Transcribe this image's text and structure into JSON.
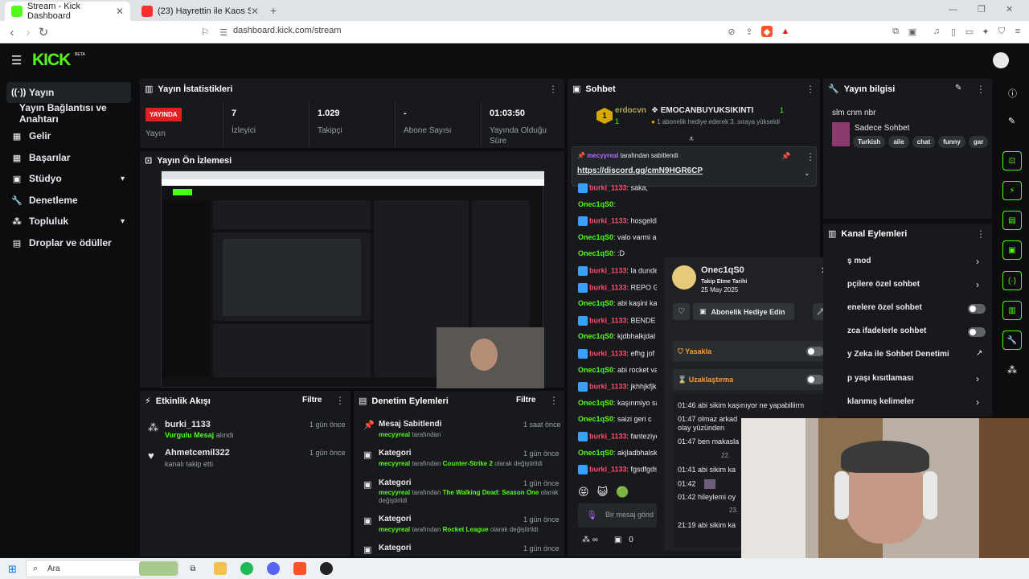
{
  "browser": {
    "tabs": [
      {
        "title": "Stream - Kick Dashboard"
      },
      {
        "title": "(23) Hayrettin ile Kaos Show - 2.Sezo"
      }
    ],
    "url": "dashboard.kick.com/stream"
  },
  "brand": {
    "logo": "KICK",
    "beta": "BETA"
  },
  "sidebar": {
    "items": [
      {
        "label": "Yayın",
        "icon": "broadcast-icon"
      },
      {
        "label": "Yayın Bağlantısı ve Anahtarı"
      },
      {
        "label": "Gelir",
        "icon": "revenue-icon"
      },
      {
        "label": "Başarılar",
        "icon": "achievements-icon"
      },
      {
        "label": "Stüdyo",
        "icon": "studio-icon"
      },
      {
        "label": "Denetleme",
        "icon": "moderation-icon"
      },
      {
        "label": "Topluluk",
        "icon": "community-icon"
      },
      {
        "label": "Droplar ve ödüller",
        "icon": "drops-icon"
      }
    ]
  },
  "stats": {
    "title": "Yayın İstatistikleri",
    "live_label": "YAYINDA",
    "status_label": "Yayın",
    "viewers": "7",
    "viewers_label": "İzleyici",
    "followers": "1.029",
    "followers_label": "Takipçi",
    "subs": "-",
    "subs_label": "Abone Sayısı",
    "uptime": "01:03:50",
    "uptime_label": "Yayında Olduğu Süre"
  },
  "preview": {
    "title": "Yayın Ön İzlemesi"
  },
  "activity": {
    "title": "Etkinlik Akışı",
    "filter": "Filtre",
    "items": [
      {
        "user": "burki_1133",
        "time": "1 gün önce",
        "detail_highlight": "Vurgulu Mesaj",
        "detail": "alındı"
      },
      {
        "user": "Ahmetcemil322",
        "time": "1 gün önce",
        "detail_highlight": "",
        "detail": "kanalı takip etti"
      }
    ]
  },
  "modlog": {
    "title": "Denetim Eylemleri",
    "filter": "Filtre",
    "items": [
      {
        "title": "Mesaj Sabitlendi",
        "time": "1 saat önce",
        "user": "mecyyreal",
        "mid": "tarafından",
        "target": "",
        "end": ""
      },
      {
        "title": "Kategori",
        "time": "1 gün önce",
        "user": "mecyyreal",
        "mid": "tarafından",
        "target": "Counter-Strike 2",
        "end": "olarak değiştirildi"
      },
      {
        "title": "Kategori",
        "time": "1 gün önce",
        "user": "mecyyreal",
        "mid": "tarafından",
        "target": "The Walking Dead: Season One",
        "end": "olarak değiştirildi"
      },
      {
        "title": "Kategori",
        "time": "1 gün önce",
        "user": "mecyyreal",
        "mid": "tarafından",
        "target": "Rocket League",
        "end": "olarak değiştirildi"
      },
      {
        "title": "Kategori",
        "time": "1 gün önce"
      }
    ]
  },
  "chat": {
    "title": "Sohbet",
    "gifter": {
      "name": "erdocvn",
      "count": "1",
      "rank": "1",
      "target": "EMOCANBUYUKSIKINTI",
      "target_count": "1",
      "note": "1 abonelik hediye ederek 3. sıraya yükseldi"
    },
    "pinned": {
      "by": "mecyyreal",
      "suffix": "tarafından sabitlendi",
      "link": "https://discord.gg/cmN9HGR6CP"
    },
    "messages": [
      {
        "user": "burki_1133",
        "text": ": saka,",
        "red": true
      },
      {
        "user": "Onec1qS0",
        "text": ":",
        "red": false
      },
      {
        "user": "burki_1133",
        "text": ": hosgeldin",
        "red": true
      },
      {
        "user": "Onec1qS0",
        "text": ": valo varmi abi bugun",
        "red": false
      },
      {
        "user": "Onec1qS0",
        "text": ": :D",
        "red": false
      },
      {
        "user": "burki_1133",
        "text": ": la dunde",
        "red": true
      },
      {
        "user": "burki_1133",
        "text": ": REPO GS",
        "red": true
      },
      {
        "user": "Onec1qS0",
        "text": ": abi kaşini ka",
        "red": false
      },
      {
        "user": "burki_1133",
        "text": ": BENDE V",
        "red": true
      },
      {
        "user": "Onec1qS0",
        "text": ": kjdbhalkjdal",
        "red": false
      },
      {
        "user": "burki_1133",
        "text": ": efhg jof",
        "red": true
      },
      {
        "user": "Onec1qS0",
        "text": ": abi rocket va",
        "red": false
      },
      {
        "user": "burki_1133",
        "text": ": jkhhjkfjk",
        "red": true
      },
      {
        "user": "Onec1qS0",
        "text": ": kaşınmiyo sa",
        "red": false
      },
      {
        "user": "Onec1qS0",
        "text": ": saizi geri c",
        "red": false
      },
      {
        "user": "burki_1133",
        "text": ": fanteziye",
        "red": true
      },
      {
        "user": "Onec1qS0",
        "text": ": akjladbhalsk",
        "red": false
      },
      {
        "user": "burki_1133",
        "text": ": fgsdfgds",
        "red": true
      }
    ],
    "input_placeholder": "Bir mesaj gönd",
    "bottom_count": "0"
  },
  "user_card": {
    "username": "Onec1qS0",
    "follow_label": "Takip Etme Tarihi",
    "follow_date": "25 May 2025",
    "gift_button": "Abonelik Hediye Edin",
    "ban_label": "Yasakla",
    "timeout_label": "Uzaklaştırma",
    "history": [
      {
        "time": "01:46",
        "text": "abi sikim kaşınıyor ne yapabiliirm"
      },
      {
        "time": "01:47",
        "text": "olmaz arkad",
        "text2": "olay yüzünden"
      },
      {
        "time": "01:47",
        "text": "ben makasla"
      },
      {
        "divider": "22."
      },
      {
        "time": "01:41",
        "text": "abi sikim ka"
      },
      {
        "time": "01:42",
        "text": ""
      },
      {
        "time": "01:42",
        "text": "hileylemi oy"
      },
      {
        "divider": "23."
      },
      {
        "time": "21:19",
        "text": "abi sikim ka"
      }
    ]
  },
  "stream_info": {
    "title": "Yayın bilgisi",
    "stream_title": "slm cnm nbr",
    "category": "Sadece Sohbet",
    "tags": [
      "Turkish",
      "aile",
      "chat",
      "funny",
      "gar"
    ]
  },
  "channel_actions": {
    "title": "Kanal Eylemleri",
    "items": [
      {
        "label": "ş mod",
        "kind": "arrow"
      },
      {
        "label": "pçilere özel sohbet",
        "kind": "arrow"
      },
      {
        "label": "enelere özel sohbet",
        "kind": "toggle"
      },
      {
        "label": "zca ifadelerle sohbet",
        "kind": "toggle"
      },
      {
        "label": "y Zeka ile Sohbet Denetimi",
        "kind": "link"
      },
      {
        "label": "p yaşı kısıtlaması",
        "kind": "arrow"
      },
      {
        "label": "klanmış kelimeler",
        "kind": "arrow"
      }
    ]
  },
  "taskbar": {
    "search": "Ara"
  },
  "colors": {
    "accent": "#53fc18",
    "live": "#e02020",
    "panel": "#18191c",
    "bg": "#0b0d0f"
  }
}
